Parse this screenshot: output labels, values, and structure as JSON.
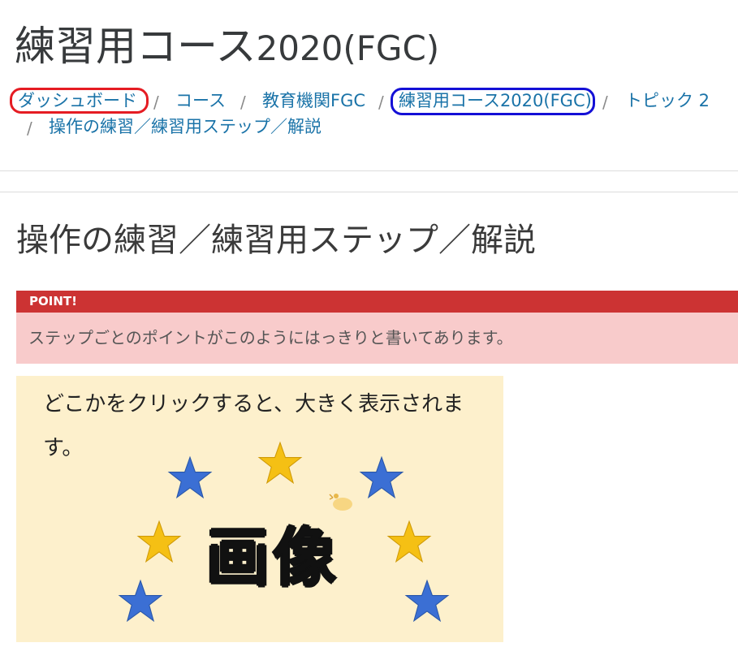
{
  "course": {
    "title": "練習用コース",
    "title_suffix": "2020(FGC)"
  },
  "breadcrumb": {
    "items": [
      {
        "label": "ダッシュボード"
      },
      {
        "label": "コース"
      },
      {
        "label": "教育機関FGC"
      },
      {
        "label": "練習用コース2020(FGC)"
      },
      {
        "label": "トピック 2"
      },
      {
        "label": "操作の練習／練習用ステップ／解説"
      }
    ],
    "separator": "/"
  },
  "annotations": {
    "red_color": "#e51c23",
    "blue_color": "#1410d6"
  },
  "page": {
    "heading": "操作の練習／練習用ステップ／解説"
  },
  "point": {
    "label": "POINT!",
    "text": "ステップごとのポイントがこのようにはっきりと書いてあります。",
    "header_color": "#cc3333",
    "body_color": "#f8cbcb"
  },
  "image": {
    "caption": "どこかをクリックすると、大きく表示されます。",
    "word": "画像",
    "background": "#fdf0cc",
    "icons": [
      "blue-star-icon",
      "gold-star-icon"
    ]
  }
}
